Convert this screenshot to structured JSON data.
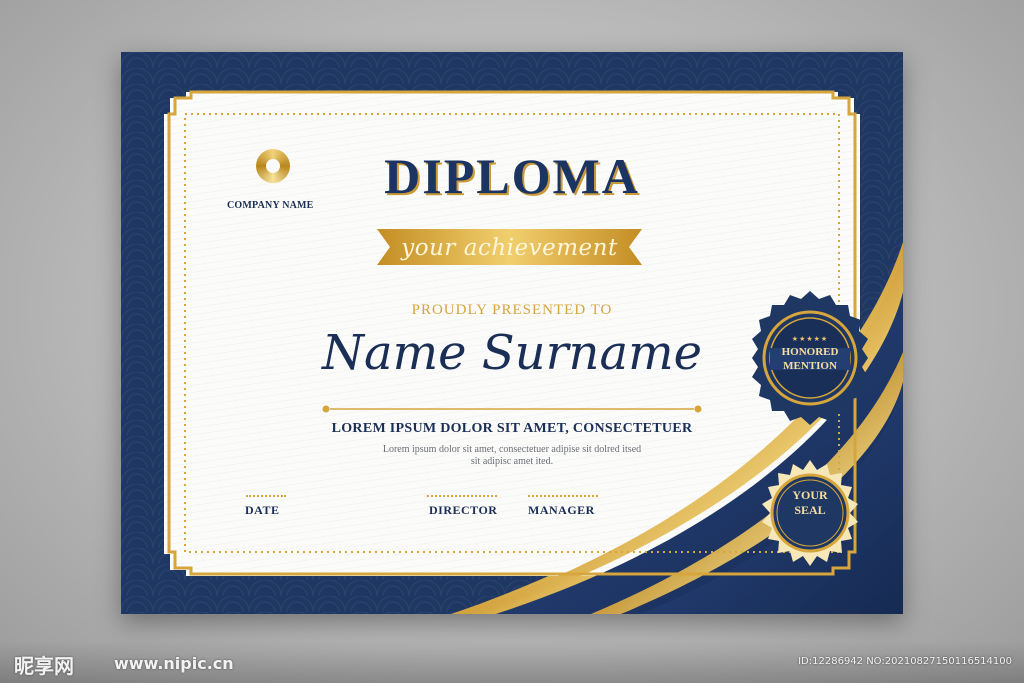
{
  "certificate": {
    "company_name": "COMPANY NAME",
    "title": "DIPLOMA",
    "subtitle": "your achievement",
    "presented_to": "PROUDLY PRESENTED TO",
    "recipient_name": "Name Surname",
    "headline": "LOREM IPSUM DOLOR SIT AMET, CONSECTETUER",
    "body_line1": "Lorem ipsum dolor sit amet, consectetuer adipise sit dolred itsed",
    "body_line2": "sit adipisc amet ited.",
    "signatures": [
      "DATE",
      "DIRECTOR",
      "MANAGER"
    ],
    "seal_honored_line1": "HONORED",
    "seal_honored_line2": "MENTION",
    "seal_honored_stars": "★★★★★",
    "seal_your_line1": "YOUR",
    "seal_your_line2": "SEAL"
  },
  "watermark": {
    "logo": "昵享网",
    "url": "www.nipic.cn",
    "id": "ID:12286942 NO:20210827150116514100"
  },
  "colors": {
    "navy": "#1e3763",
    "gold": "#d6a63c",
    "paper": "#fbfbfa"
  }
}
